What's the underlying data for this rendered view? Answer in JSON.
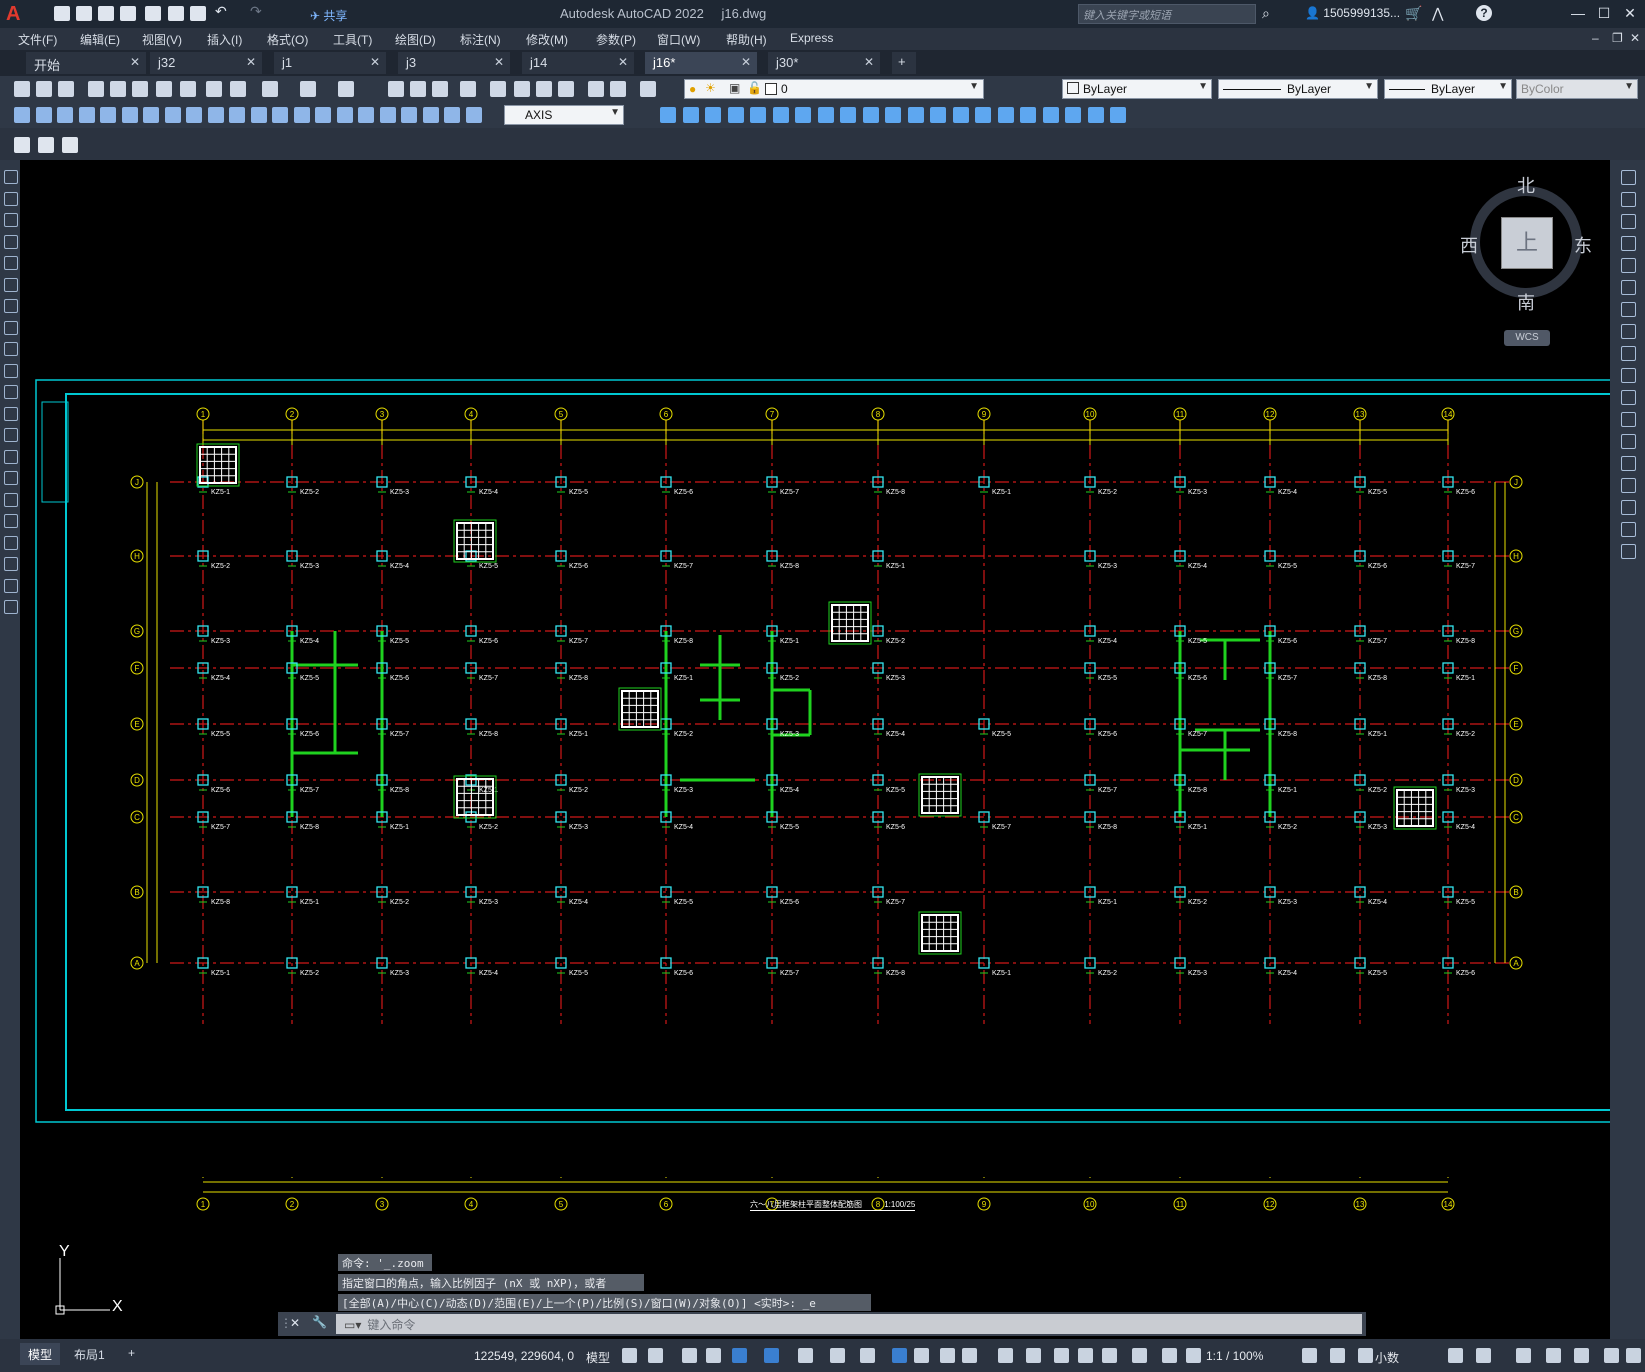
{
  "titlebar": {
    "app_name": "Autodesk AutoCAD 2022",
    "file_name": "j16.dwg",
    "share_label": "共享",
    "search_placeholder": "键入关键字或短语",
    "user": "1505999135..."
  },
  "menu": [
    "文件(F)",
    "编辑(E)",
    "视图(V)",
    "插入(I)",
    "格式(O)",
    "工具(T)",
    "绘图(D)",
    "标注(N)",
    "修改(M)",
    "参数(P)",
    "窗口(W)",
    "帮助(H)",
    "Express"
  ],
  "tabs": [
    {
      "label": "开始",
      "active": false
    },
    {
      "label": "j32",
      "active": false
    },
    {
      "label": "j1",
      "active": false
    },
    {
      "label": "j3",
      "active": false
    },
    {
      "label": "j14",
      "active": false
    },
    {
      "label": "j16*",
      "active": true
    },
    {
      "label": "j30*",
      "active": false
    }
  ],
  "layers": {
    "current_layer": "0",
    "color": "ByLayer",
    "linetype": "ByLayer",
    "lineweight": "ByLayer",
    "plotstyle": "ByColor",
    "dimstyle": "AXIS"
  },
  "viewcube": {
    "north": "北",
    "south": "南",
    "east": "东",
    "west": "西",
    "top": "上",
    "wcs": "WCS"
  },
  "drawing": {
    "axis_numbers": [
      "1",
      "2",
      "3",
      "4",
      "5",
      "6",
      "7",
      "8",
      "9",
      "10",
      "11",
      "12",
      "13",
      "14"
    ],
    "axis_letters": [
      "J",
      "H",
      "G",
      "F",
      "E",
      "D",
      "C",
      "B",
      "A"
    ],
    "plan_title": "六～八层框架柱平面整体配筋图",
    "scale": "1:100/25",
    "column_labels": [
      "KZ5-1",
      "KZ5-2",
      "KZ5-3",
      "KZ5-4",
      "KZ5-5",
      "KZ5-6",
      "KZ5-7",
      "KZ5-8"
    ]
  },
  "command": {
    "history": [
      "命令: '_.zoom",
      "指定窗口的角点，输入比例因子 (nX 或 nXP)，或者",
      "[全部(A)/中心(C)/动态(D)/范围(E)/上一个(P)/比例(S)/窗口(W)/对象(O)] <实时>: _e"
    ],
    "placeholder": "键入命令"
  },
  "ucs": {
    "x": "X",
    "y": "Y"
  },
  "status": {
    "tabs": [
      "模型",
      "布局1"
    ],
    "coords": "122549, 229604, 0",
    "space": "模型",
    "scale": "1:1 / 100%",
    "units": "小数"
  }
}
